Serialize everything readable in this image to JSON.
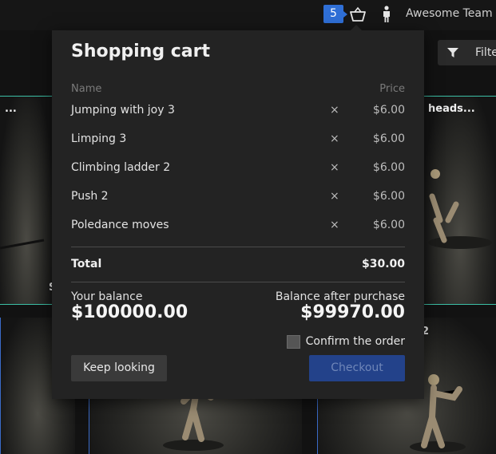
{
  "topbar": {
    "cart_count": "5",
    "team_name": "Awesome Team"
  },
  "background": {
    "filter_label": "Filte",
    "tile_labels": [
      "...",
      "heads...",
      "S",
      "2"
    ]
  },
  "cart": {
    "title": "Shopping cart",
    "col_name": "Name",
    "col_price": "Price",
    "remove_glyph": "×",
    "items": [
      {
        "name": "Jumping with joy 3",
        "price": "$6.00"
      },
      {
        "name": "Limping 3",
        "price": "$6.00"
      },
      {
        "name": "Climbing ladder 2",
        "price": "$6.00"
      },
      {
        "name": "Push 2",
        "price": "$6.00"
      },
      {
        "name": "Poledance moves",
        "price": "$6.00"
      }
    ],
    "total_label": "Total",
    "total_value": "$30.00",
    "balance_label": "Your balance",
    "balance_value": "$100000.00",
    "after_label": "Balance after purchase",
    "after_value": "$99970.00",
    "confirm_label": "Confirm the order",
    "confirm_checked": false,
    "keep_label": "Keep looking",
    "checkout_label": "Checkout"
  },
  "colors": {
    "accent_blue": "#2f6fd6",
    "checkout_disabled": "#23428a",
    "tile_border_teal": "#3cc0a6"
  },
  "icons": [
    "basket-icon",
    "person-icon",
    "filter-icon",
    "close-icon"
  ]
}
